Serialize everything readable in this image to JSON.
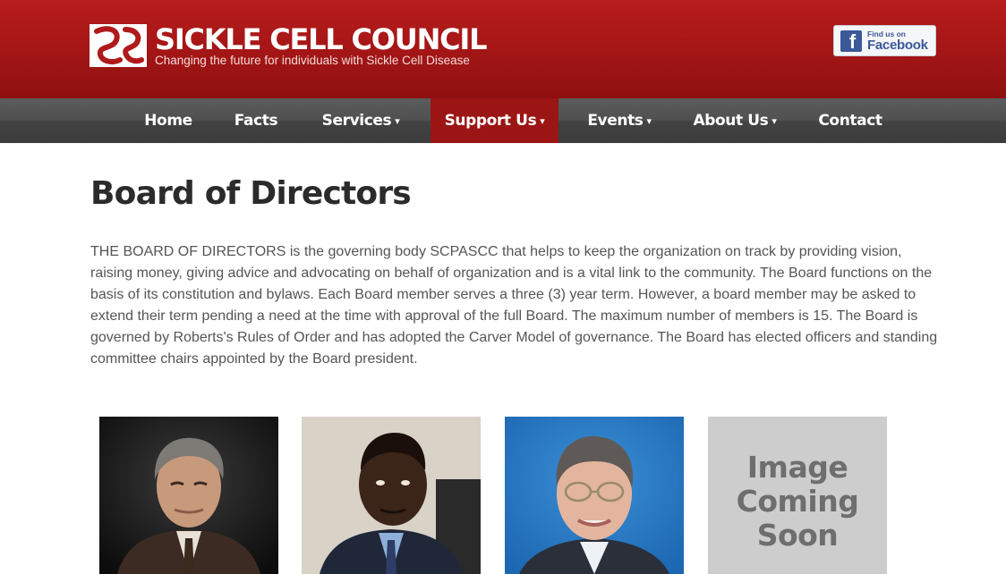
{
  "header": {
    "site_title": "SICKLE CELL COUNCIL",
    "tagline": "Changing the future for individuals with Sickle Cell Disease",
    "facebook_small": "Find us on",
    "facebook_big": "Facebook"
  },
  "nav": {
    "items": [
      {
        "label": "Home"
      },
      {
        "label": "Facts"
      },
      {
        "label": "Services",
        "caret": "▾"
      },
      {
        "label": "Support Us",
        "caret": "▾",
        "active": true
      },
      {
        "label": "Events",
        "caret": "▾"
      },
      {
        "label": "About Us",
        "caret": "▾"
      },
      {
        "label": "Contact"
      }
    ]
  },
  "main": {
    "title": "Board of Directors",
    "intro": "THE BOARD OF DIRECTORS is the governing body SCPASCC that helps to keep the organization on track by providing vision, raising money, giving advice and advocating on behalf of organization and is a vital link to the community. The Board functions on the basis of its constitution and bylaws. Each Board member serves a three (3) year term. However, a board member may be asked to extend their term pending a need at the time with approval of the full Board. The maximum number of members is 15. The Board is governed by Roberts's Rules of Order and has adopted the Carver Model of governance. The Board has elected officers and standing committee chairs appointed by the Board president.",
    "placeholder_text": "Image Coming Soon"
  },
  "colors": {
    "brand_red": "#a51616",
    "nav_active": "#9b1515",
    "nav_bg": "#4a4a4a",
    "facebook_blue": "#3b5998"
  },
  "icons": {
    "logo": "sickle-cell-logo-icon",
    "facebook": "facebook-f-icon"
  }
}
